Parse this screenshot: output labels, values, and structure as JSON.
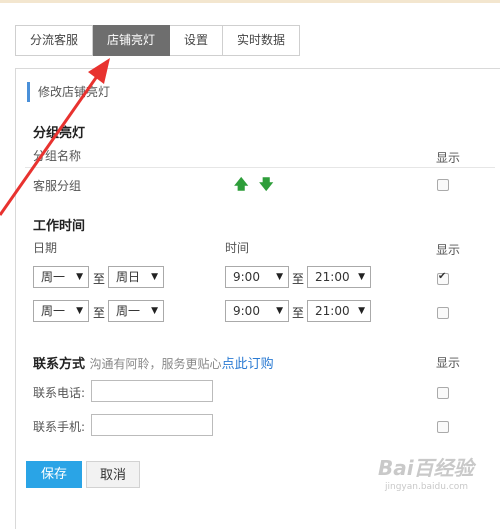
{
  "tabs": [
    {
      "label": "分流客服"
    },
    {
      "label": "店铺亮灯",
      "active": true
    },
    {
      "label": "设置"
    },
    {
      "label": "实时数据"
    }
  ],
  "crumb": "修改店铺亮灯",
  "group": {
    "heading": "分组亮灯",
    "col_name": "分组名称",
    "col_show": "显示",
    "row_name": "客服分组",
    "show_checked": false
  },
  "worktime": {
    "heading": "工作时间",
    "col_date": "日期",
    "col_time": "时间",
    "col_show": "显示",
    "sep": "至",
    "rows": [
      {
        "from_day": "周一",
        "to_day": "周日",
        "from_time": "9:00",
        "to_time": "21:00",
        "show_checked": true
      },
      {
        "from_day": "周一",
        "to_day": "周一",
        "from_time": "9:00",
        "to_time": "21:00",
        "show_checked": false
      }
    ]
  },
  "contact": {
    "heading": "联系方式",
    "hint": "沟通有阿聆，服务更贴心",
    "link": "点此订购",
    "col_show": "显示",
    "phone_label": "联系电话:",
    "mobile_label": "联系手机:",
    "phone_value": "",
    "mobile_value": ""
  },
  "buttons": {
    "save": "保存",
    "cancel": "取消"
  },
  "watermark": {
    "brand": "Bai百经验",
    "url": "jingyan.baidu.com"
  },
  "colors": {
    "accent": "#2aa4e6",
    "active_tab": "#6e6e6e",
    "arrow": "#e8322f",
    "green": "#2e9e3a"
  }
}
